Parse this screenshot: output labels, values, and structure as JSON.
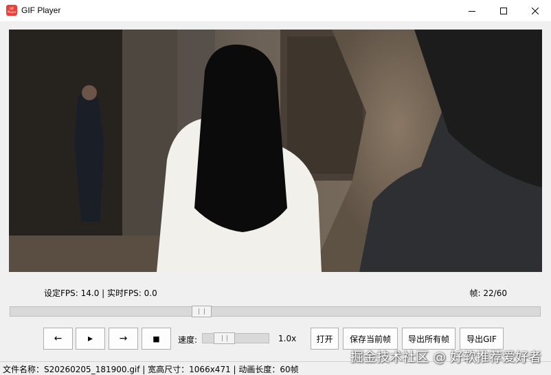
{
  "window": {
    "title": "GIF Player",
    "icon_text": "GIF Player",
    "minimize_icon": "minimize-icon",
    "maximize_icon": "maximize-icon",
    "close_icon": "close-icon"
  },
  "info": {
    "fps_text": "设定FPS: 14.0 | 实时FPS: 0.0",
    "frame_text": "帧: 22/60"
  },
  "seek": {
    "current_frame": 22,
    "total_frames": 60
  },
  "controls": {
    "prev_label": "←",
    "play_label": "▸",
    "next_label": "→",
    "stop_label": "■"
  },
  "speed": {
    "label": "速度:",
    "value": "1.0x",
    "level": 0.25
  },
  "actions": {
    "open": "打开",
    "save_frame": "保存当前帧",
    "export_frames": "导出所有帧",
    "export_gif": "导出GIF"
  },
  "status": {
    "text": "文件名称：S20260205_181900.gif | 宽高尺寸：1066x471 | 动画长度：60帧"
  },
  "watermark": "掘金技术社区 @ 好软推荐爱好者",
  "colors": {
    "accent_icon": "#e8413a",
    "window_bg": "#f0f0f0"
  }
}
